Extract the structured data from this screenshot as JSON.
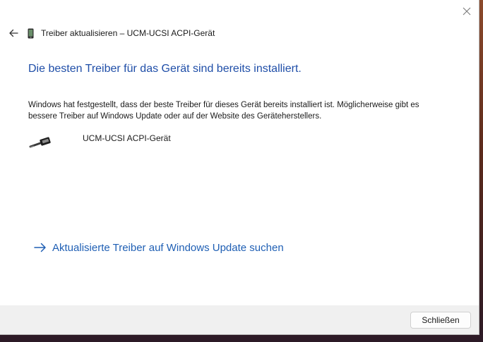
{
  "window": {
    "title": "Treiber aktualisieren – UCM-UCSI ACPI-Gerät",
    "back_icon": "back-arrow-icon",
    "device_category_icon": "phone-icon",
    "close_icon": "close-icon"
  },
  "content": {
    "heading": "Die besten Treiber für das Gerät sind bereits installiert.",
    "message": "Windows hat festgestellt, dass der beste Treiber für dieses Gerät bereits installiert ist. Möglicherweise gibt es bessere Treiber auf Windows Update oder auf der Website des Geräteherstellers.",
    "device": {
      "name": "UCM-UCSI ACPI-Gerät",
      "icon": "usb-connector-icon"
    },
    "update_link": {
      "label": "Aktualisierte Treiber auf Windows Update suchen",
      "icon": "arrow-right-icon"
    }
  },
  "footer": {
    "close_button_label": "Schließen"
  },
  "colors": {
    "heading": "#1f4ea8",
    "link": "#1f5fb4",
    "footer_bg": "#f0f0f0"
  }
}
